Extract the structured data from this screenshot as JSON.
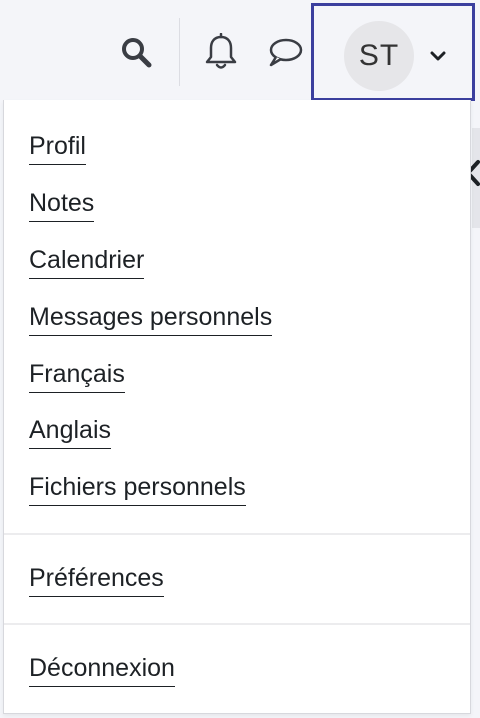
{
  "navbar": {
    "user_initials": "ST",
    "icons": {
      "search": "search-icon",
      "notifications": "bell-icon",
      "messages": "chat-bubble-icon",
      "user_menu_caret": "chevron-down-icon"
    },
    "accent_color": "#3b3f9e"
  },
  "user_menu": {
    "items": [
      {
        "label": "Profil"
      },
      {
        "label": "Notes"
      },
      {
        "label": "Calendrier"
      },
      {
        "label": "Messages personnels"
      },
      {
        "label": "Français"
      },
      {
        "label": "Anglais"
      },
      {
        "label": "Fichiers personnels"
      }
    ],
    "preferences": "Préférences",
    "logout": "Déconnexion"
  }
}
